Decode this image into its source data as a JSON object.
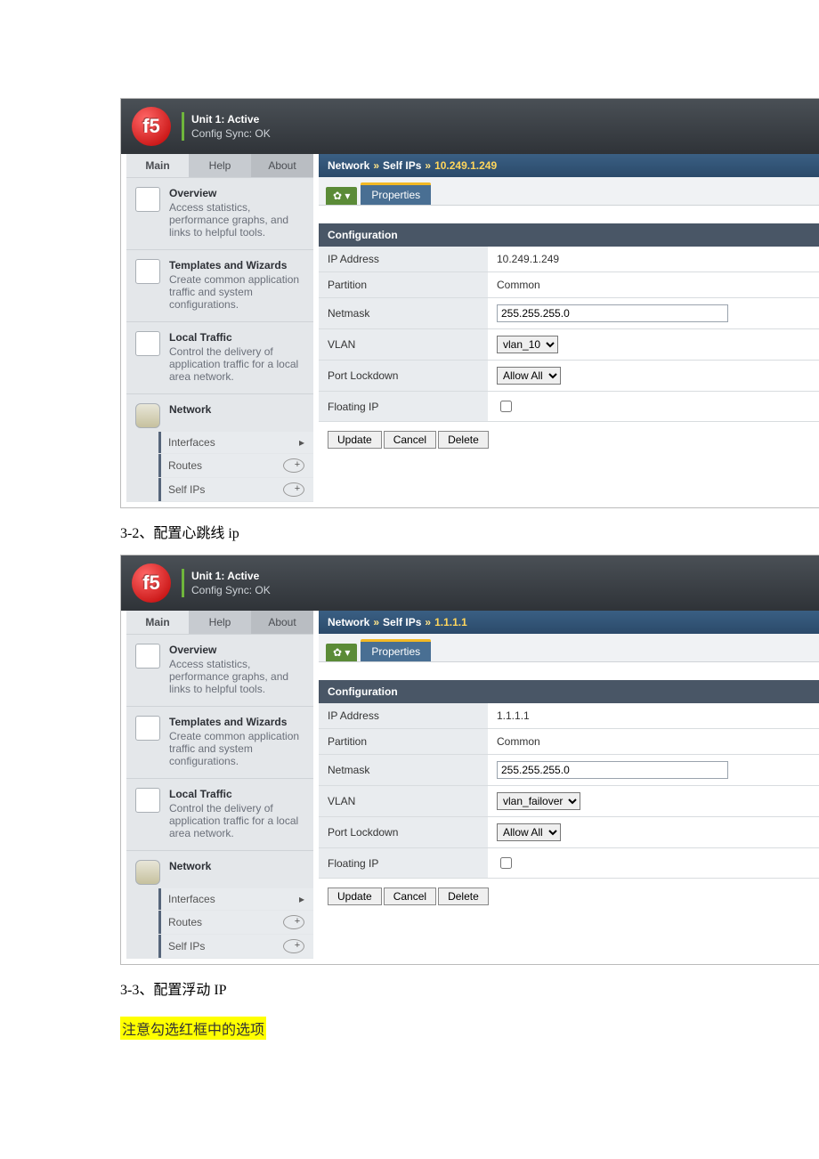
{
  "status": {
    "unit": "Unit 1: Active",
    "sync": "Config Sync: OK"
  },
  "tabs": {
    "main": "Main",
    "help": "Help",
    "about": "About"
  },
  "nav": {
    "overview": {
      "h": "Overview",
      "d": "Access statistics, performance graphs, and links to helpful tools."
    },
    "templates": {
      "h": "Templates and Wizards",
      "d": "Create common application traffic and system configurations."
    },
    "local": {
      "h": "Local Traffic",
      "d": "Control the delivery of application traffic for a local area network."
    },
    "network": {
      "h": "Network"
    },
    "sub": {
      "if": "Interfaces",
      "rt": "Routes",
      "sip": "Self IPs"
    }
  },
  "crumb": {
    "a": "Network",
    "b": "Self IPs",
    "sep": "»"
  },
  "tabbar": {
    "gear": "✿ ▾",
    "prop": "Properties"
  },
  "labels": {
    "conf": "Configuration",
    "ip": "IP Address",
    "part": "Partition",
    "mask": "Netmask",
    "vlan": "VLAN",
    "pl": "Port Lockdown",
    "fip": "Floating IP"
  },
  "btn": {
    "upd": "Update",
    "can": "Cancel",
    "del": "Delete"
  },
  "s1": {
    "crumb_cur": "10.249.1.249",
    "ip": "10.249.1.249",
    "part": "Common",
    "mask": "255.255.255.0",
    "vlan": "vlan_10",
    "pl": "Allow All"
  },
  "s2": {
    "crumb_cur": "1.1.1.1",
    "ip": "1.1.1.1",
    "part": "Common",
    "mask": "255.255.255.0",
    "vlan": "vlan_failover",
    "pl": "Allow All"
  },
  "cap1": "3-2、配置心跳线 ip",
  "cap2": "3-3、配置浮动 IP",
  "note": "注意勾选红框中的选项"
}
